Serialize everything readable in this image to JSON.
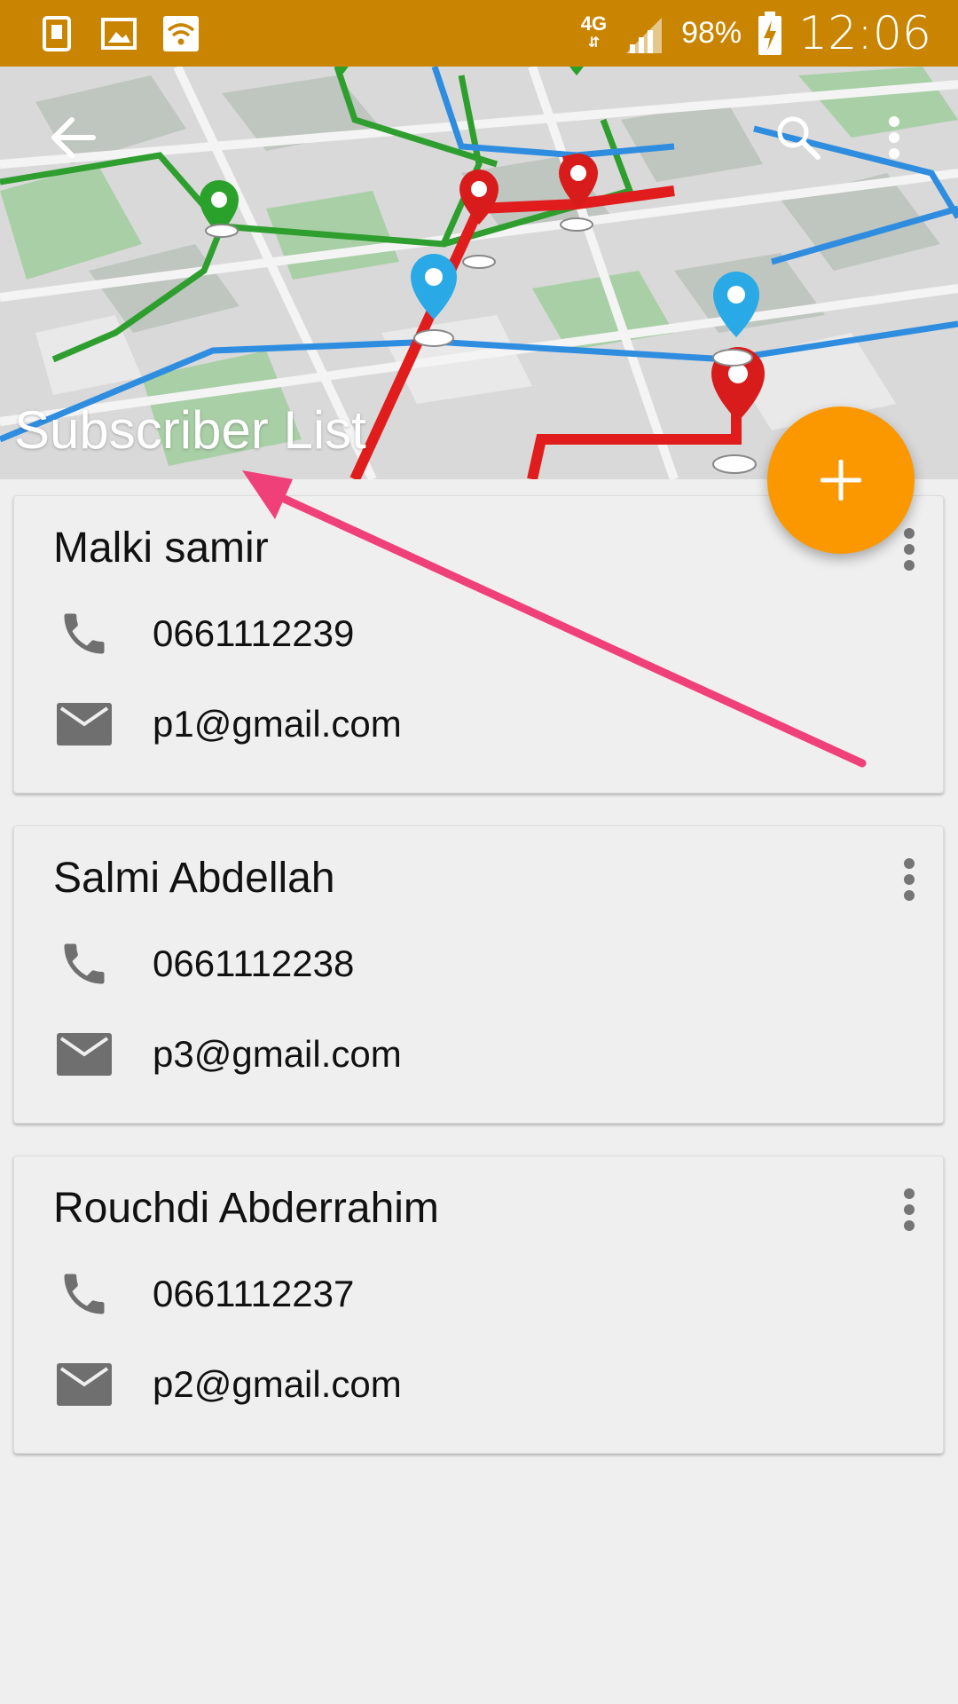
{
  "status_bar": {
    "network": "4G",
    "battery": "98%",
    "time": "12:06"
  },
  "header": {
    "title": "Subscriber List",
    "icons": {
      "back": "arrow-back-icon",
      "search": "search-icon",
      "menu": "more-vert-icon"
    }
  },
  "fab": {
    "label": "+",
    "icon": "add-icon",
    "color": "#fb9800"
  },
  "subscribers": [
    {
      "name": "Malki samir",
      "phone": "0661112239",
      "email": "p1@gmail.com"
    },
    {
      "name": "Salmi Abdellah",
      "phone": "0661112238",
      "email": "p3@gmail.com"
    },
    {
      "name": "Rouchdi Abderrahim",
      "phone": "0661112237",
      "email": "p2@gmail.com"
    }
  ],
  "colors": {
    "status_bar": "#c98502",
    "accent": "#fb9800",
    "annotation_arrow": "#f0407a",
    "background": "#efefef"
  }
}
